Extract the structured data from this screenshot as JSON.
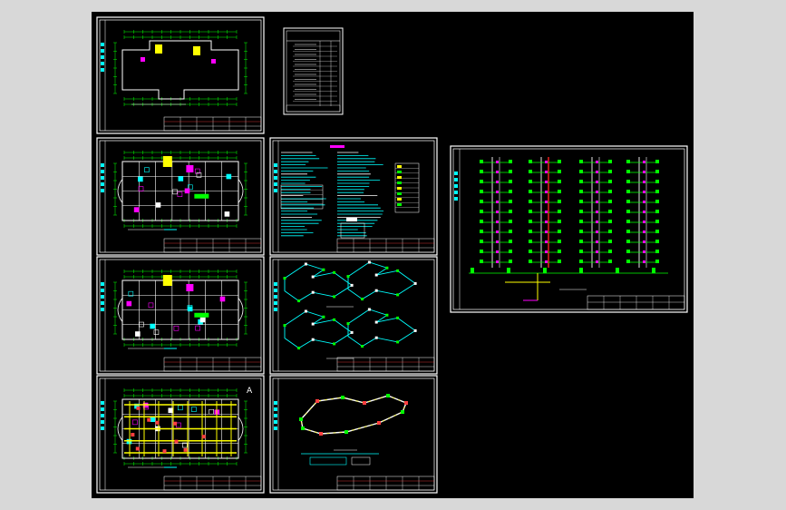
{
  "app": {
    "background": "#d8d8d8",
    "canvas_color": "#000000"
  },
  "drawing": {
    "sheets": [
      {
        "id": "sheet-site-plan",
        "kind": "floor-plan",
        "style": "sparse"
      },
      {
        "id": "sheet-drawing-list",
        "kind": "table"
      },
      {
        "id": "sheet-floor-plan-1",
        "kind": "floor-plan",
        "style": "dense"
      },
      {
        "id": "sheet-design-notes",
        "kind": "notes"
      },
      {
        "id": "sheet-system-diagram",
        "kind": "riser"
      },
      {
        "id": "sheet-floor-plan-2",
        "kind": "floor-plan",
        "style": "dense"
      },
      {
        "id": "sheet-isometric-1",
        "kind": "isometric"
      },
      {
        "id": "sheet-floor-plan-3",
        "kind": "floor-plan",
        "style": "yellow"
      },
      {
        "id": "sheet-isometric-2",
        "kind": "isometric-single"
      }
    ],
    "corner_mark": "A",
    "colors": {
      "frame": "#ffffff",
      "plan": "#ffffff",
      "dimension": "#00ff00",
      "pipe": "#00ffff",
      "fixture": "#ff00ff",
      "riser_red": "#ff2020",
      "highlight": "#ffff00"
    }
  }
}
